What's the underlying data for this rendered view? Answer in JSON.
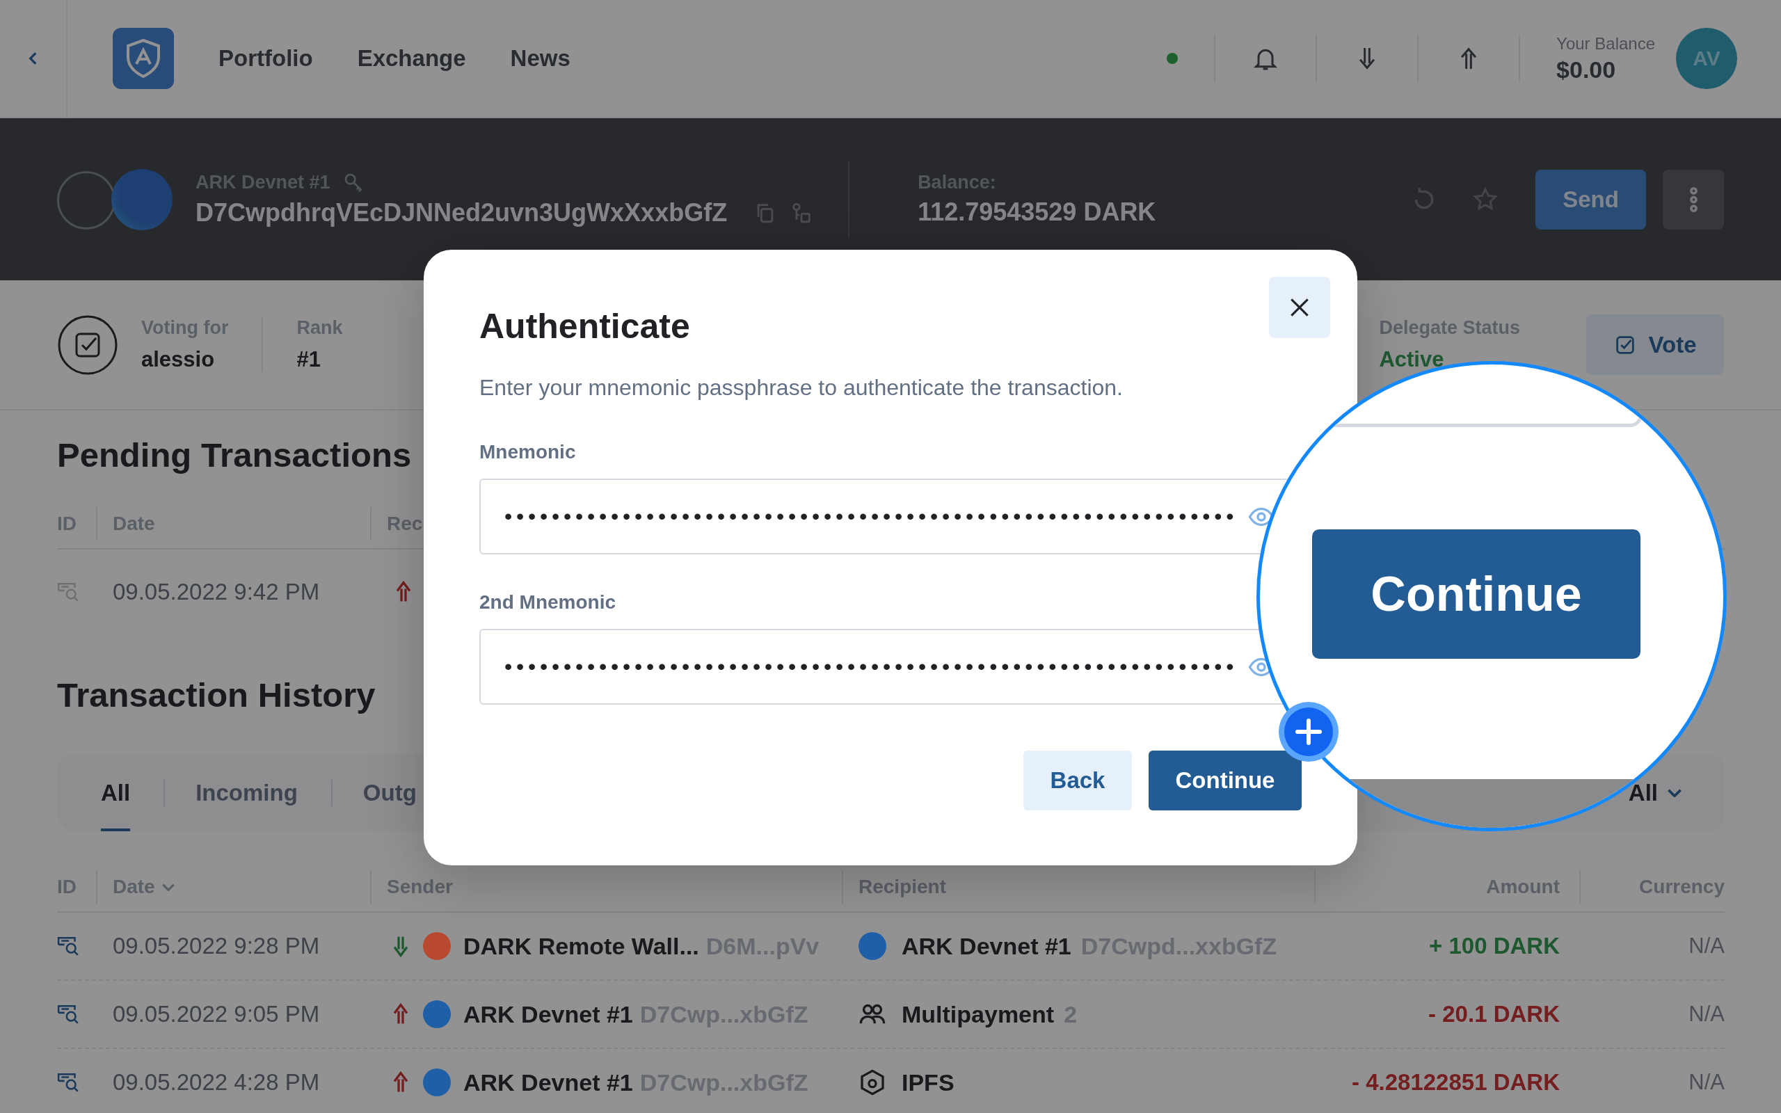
{
  "nav": {
    "links": [
      {
        "label": "Portfolio"
      },
      {
        "label": "Exchange"
      },
      {
        "label": "News"
      }
    ],
    "balance_label": "Your Balance",
    "balance": "$0.00",
    "avatar": "AV"
  },
  "wallet": {
    "name": "ARK Devnet #1",
    "address": "D7CwpdhrqVEcDJNNed2uvn3UgWxXxxbGfZ",
    "balance_label": "Balance:",
    "balance": "112.79543529 DARK",
    "send_label": "Send"
  },
  "voting": {
    "voting_for_label": "Voting for",
    "delegate": "alessio",
    "rank_label": "Rank",
    "rank": "#1",
    "status_label": "Delegate Status",
    "status": "Active",
    "vote_label": "Vote"
  },
  "pending": {
    "title": "Pending Transactions",
    "columns": [
      "ID",
      "Date",
      "Rec"
    ],
    "rows": [
      {
        "date": "09.05.2022 9:42 PM",
        "incoming": false
      }
    ]
  },
  "history": {
    "title": "Transaction History",
    "tabs": [
      {
        "label": "All",
        "selected": true
      },
      {
        "label": "Incoming",
        "selected": false
      },
      {
        "label": "Outg",
        "selected": false
      }
    ],
    "filter": "All",
    "columns": [
      "ID",
      "Date",
      "Sender",
      "Recipient",
      "Amount",
      "Currency"
    ],
    "rows": [
      {
        "date": "09.05.2022 9:28 PM",
        "incoming": true,
        "sender": {
          "name": "DARK Remote Wall...",
          "address": "D6M...pVv",
          "color": "#b8492f"
        },
        "recipient": {
          "kind": "wallet",
          "name": "ARK Devnet #1",
          "detail": "D7Cwpd...xxbGfZ",
          "color": "#1f5fa8"
        },
        "amount": "+ 100 DARK",
        "currency": "N/A"
      },
      {
        "date": "09.05.2022 9:05 PM",
        "incoming": false,
        "sender": {
          "name": "ARK Devnet #1",
          "address": "D7Cwp...xbGfZ",
          "color": "#1f5fa8"
        },
        "recipient": {
          "kind": "multipayment",
          "name": "Multipayment",
          "detail": "2"
        },
        "amount": "- 20.1 DARK",
        "currency": "N/A"
      },
      {
        "date": "09.05.2022 4:28 PM",
        "incoming": false,
        "sender": {
          "name": "ARK Devnet #1",
          "address": "D7Cwp...xbGfZ",
          "color": "#1f5fa8"
        },
        "recipient": {
          "kind": "ipfs",
          "name": "IPFS"
        },
        "amount": "- 4.28122851 DARK",
        "currency": "N/A"
      }
    ]
  },
  "modal": {
    "title": "Authenticate",
    "description": "Enter your mnemonic passphrase to authenticate the transaction.",
    "fields": [
      {
        "label": "Mnemonic",
        "value": "••••••••••••••••••••••••••••••••••••••••••••••••••••••••••••••"
      },
      {
        "label": "2nd Mnemonic",
        "value": "••••••••••••••••••••••••••••••••••••••••••••••••••••••••••••••"
      }
    ],
    "back_label": "Back",
    "continue_label": "Continue"
  },
  "magnifier": {
    "button_label": "Continue"
  }
}
